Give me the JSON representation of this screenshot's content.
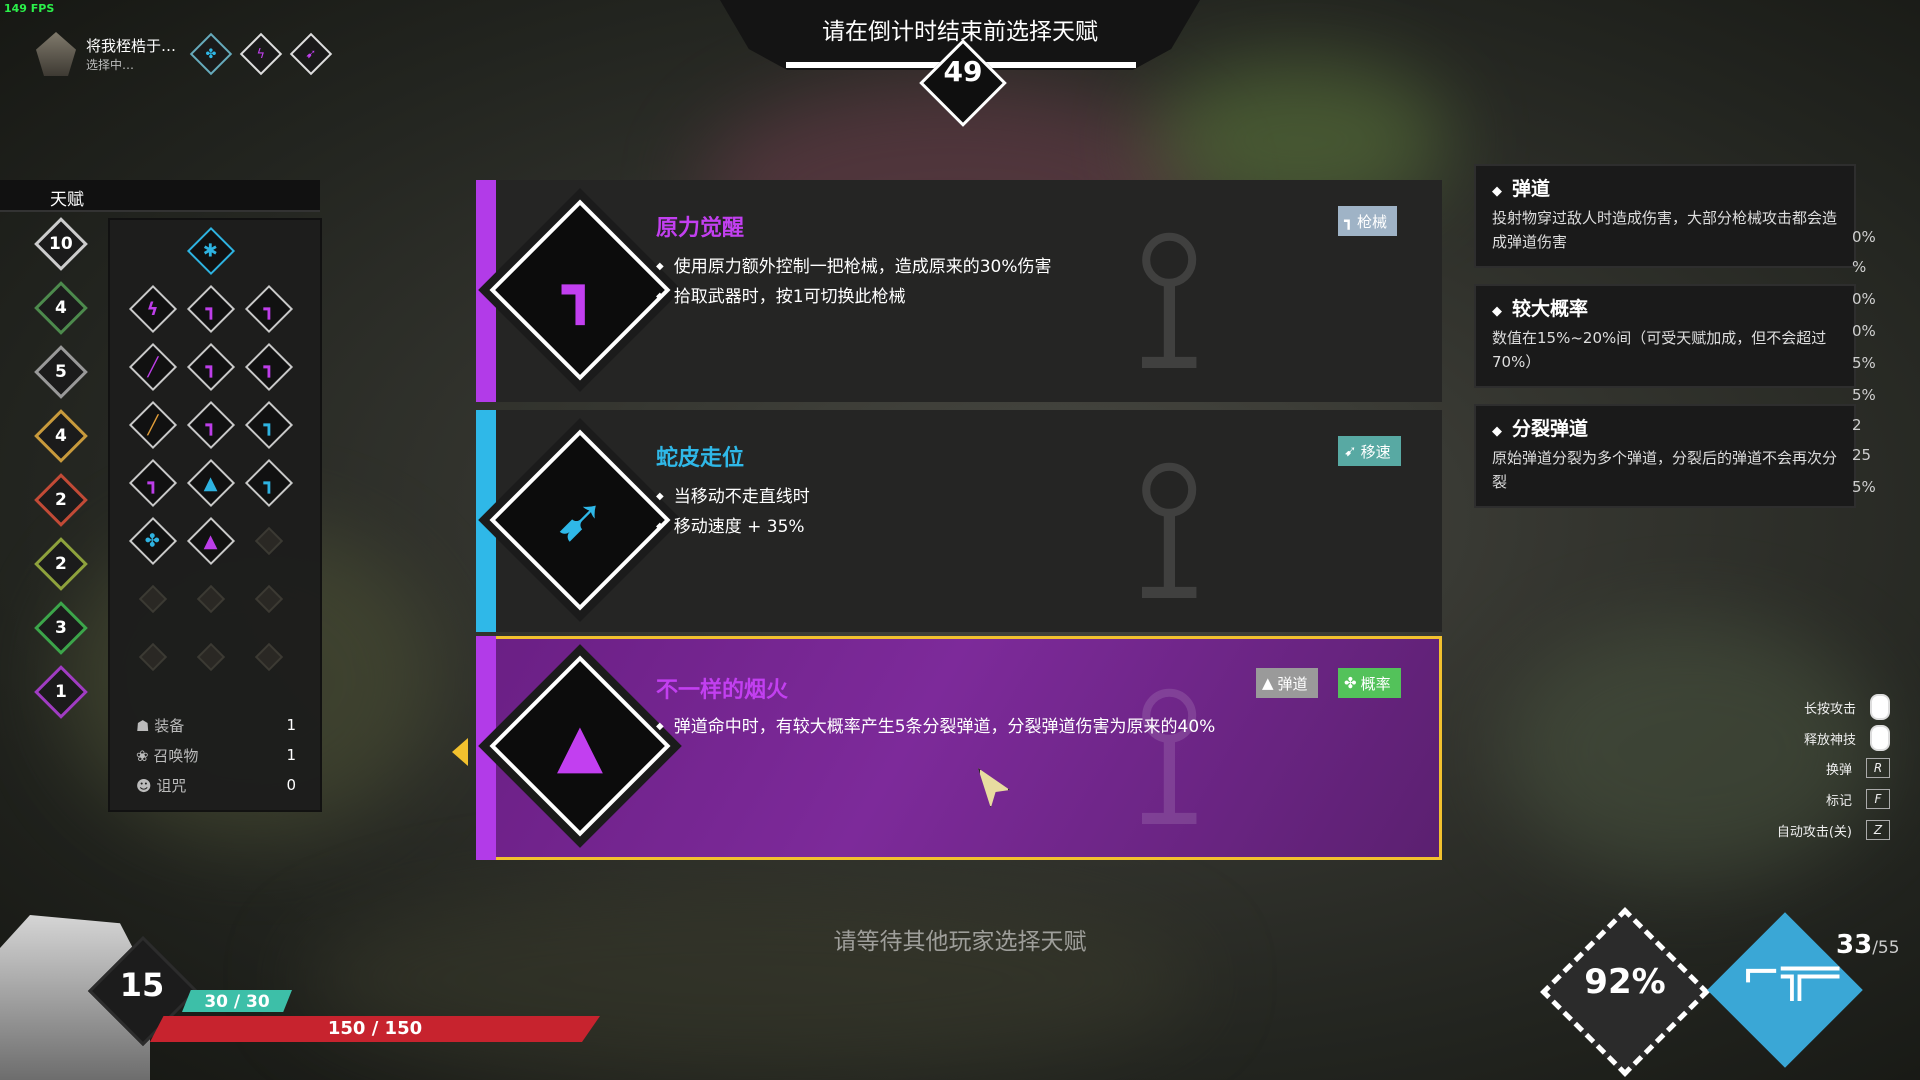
{
  "fps": "149 FPS",
  "player": {
    "name": "将我桎梏于…",
    "status": "选择中…"
  },
  "banner": {
    "title": "请在倒计时结束前选择天赋",
    "countdown": "49"
  },
  "talent_panel": {
    "tab_label": "天赋",
    "levels": [
      "10",
      "4",
      "5",
      "4",
      "2",
      "2",
      "3",
      "1"
    ],
    "stats": [
      {
        "label": "装备",
        "value": "1",
        "icon": "helmet-icon"
      },
      {
        "label": "召唤物",
        "value": "1",
        "icon": "paw-icon"
      },
      {
        "label": "诅咒",
        "value": "0",
        "icon": "demon-icon"
      }
    ]
  },
  "cards": [
    {
      "title": "原力觉醒",
      "title_color": "#c23ff0",
      "accent": "#b23be8",
      "lines": [
        "使用原力额外控制一把枪械，造成原来的30%伤害",
        "拾取武器时，按1可切换此枪械"
      ],
      "tags": [
        {
          "label": "枪械",
          "bg": "#9fb3c6",
          "icon": "gun-icon"
        }
      ],
      "glyph": "gun-icon",
      "glyph_color": "#c23ff0"
    },
    {
      "title": "蛇皮走位",
      "title_color": "#2fb8e8",
      "accent": "#2fb8e8",
      "lines": [
        "当移动不走直线时",
        "移动速度 + 35%"
      ],
      "tags": [
        {
          "label": "移速",
          "bg": "#58a9a3",
          "icon": "boot-icon"
        }
      ],
      "glyph": "boot-icon",
      "glyph_color": "#2fb8e8"
    },
    {
      "title": "不一样的烟火",
      "title_color": "#c23ff0",
      "accent": "#b23be8",
      "lines": [
        "弹道命中时，有较大概率产生5条分裂弹道，分裂弹道伤害为原来的40%"
      ],
      "tags": [
        {
          "label": "弹道",
          "bg": "#9a9a9a",
          "icon": "bullet-icon"
        },
        {
          "label": "概率",
          "bg": "#53c25a",
          "icon": "clover-icon"
        }
      ],
      "glyph": "bullet-icon",
      "glyph_color": "#c23ff0",
      "selected": true
    }
  ],
  "tooltips": [
    {
      "title": "弹道",
      "body": "投射物穿过敌人时造成伤害，大部分枪械攻击都会造成弹道伤害"
    },
    {
      "title": "较大概率",
      "body": "数值在15%~20%间（可受天赋加成，但不会超过70%）"
    },
    {
      "title": "分裂弹道",
      "body": "原始弹道分裂为多个弹道，分裂后的弹道不会再次分裂"
    }
  ],
  "right_edge_values": [
    "0%",
    "%",
    "0%",
    "0%",
    "5%",
    "5%",
    "2",
    "25",
    "5%"
  ],
  "controls": [
    {
      "label": "长按攻击",
      "key": "mouse-left"
    },
    {
      "label": "释放神技",
      "key": "mouse-right"
    },
    {
      "label": "换弹",
      "key": "R"
    },
    {
      "label": "标记",
      "key": "F"
    },
    {
      "label": "自动攻击(关)",
      "key": "Z"
    }
  ],
  "wait_text": "请等待其他玩家选择天赋",
  "hero": {
    "level": "15",
    "shield": "30 / 30",
    "hp": "150 / 150"
  },
  "hud": {
    "charge": "92%",
    "ammo_current": "33",
    "ammo_total": "/55"
  }
}
